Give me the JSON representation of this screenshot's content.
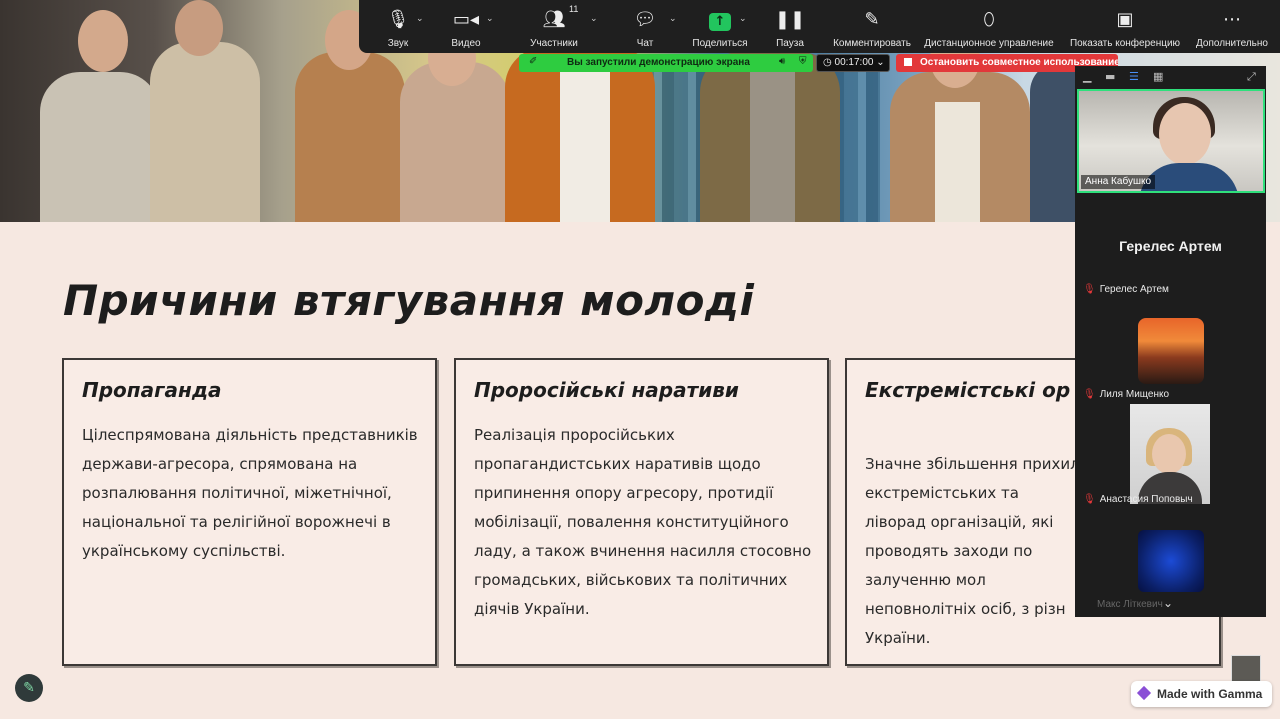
{
  "toolbar": {
    "items": [
      {
        "label": "Звук",
        "icon": "microphone-icon"
      },
      {
        "label": "Видео",
        "icon": "video-camera-icon"
      },
      {
        "label": "Участники",
        "icon": "participants-icon",
        "count": "11"
      },
      {
        "label": "Чат",
        "icon": "chat-icon"
      },
      {
        "label": "Поделиться",
        "icon": "share-screen-icon"
      },
      {
        "label": "Пауза",
        "icon": "pause-icon"
      },
      {
        "label": "Комментировать",
        "icon": "annotate-pen-icon"
      },
      {
        "label": "Дистанционное управление",
        "icon": "mouse-icon"
      },
      {
        "label": "Показать конференцию",
        "icon": "show-meeting-icon"
      },
      {
        "label": "Дополнительно",
        "icon": "more-icon"
      }
    ]
  },
  "share_status": {
    "banner": "Вы запустили демонстрацию экрана",
    "timer": "00:17:00",
    "stop_label": "Остановить совместное использование"
  },
  "slide": {
    "title": "Причини втягування молоді",
    "cards": [
      {
        "heading": "Пропаганда",
        "text": "Цілеспрямована діяльність представників держави-агресора, спрямована на розпалювання політичної, міжетнічної, національної та релігійної ворожнечі в українському суспільстві."
      },
      {
        "heading": "Проросійські наративи",
        "text": "Реалізація проросійських пропагандистських наративів щодо припинення опору агресору, протидії мобілізації, повалення конституційного ладу, а також вчинення насилля стосовно громадських, військових та політичних діячів України."
      },
      {
        "heading": "Екстремістські ор",
        "text": "Значне збільшення прихил екстремістських та ліворад організацій, які проводять заходи по залученню мол неповнолітніх осіб, з різн України."
      }
    ],
    "made_with": "Made with Gamma"
  },
  "participants": {
    "active_speaker": "Анна Кабушко",
    "spotlight_name": "Герелес Артем",
    "list": [
      {
        "name": "Герелес Артем",
        "muted": true
      },
      {
        "name": "Лиля Мищенко",
        "muted": true
      },
      {
        "name": "Анастасия Поповыч",
        "muted": true
      },
      {
        "name": "Макс Літкевич",
        "muted": true
      }
    ]
  },
  "colors": {
    "slide_bg": "#f6e8e1",
    "toolbar_bg": "#1f1f1f",
    "share_green": "#2ecc40",
    "stop_red": "#e2383a",
    "active_border": "#2fe07c"
  }
}
